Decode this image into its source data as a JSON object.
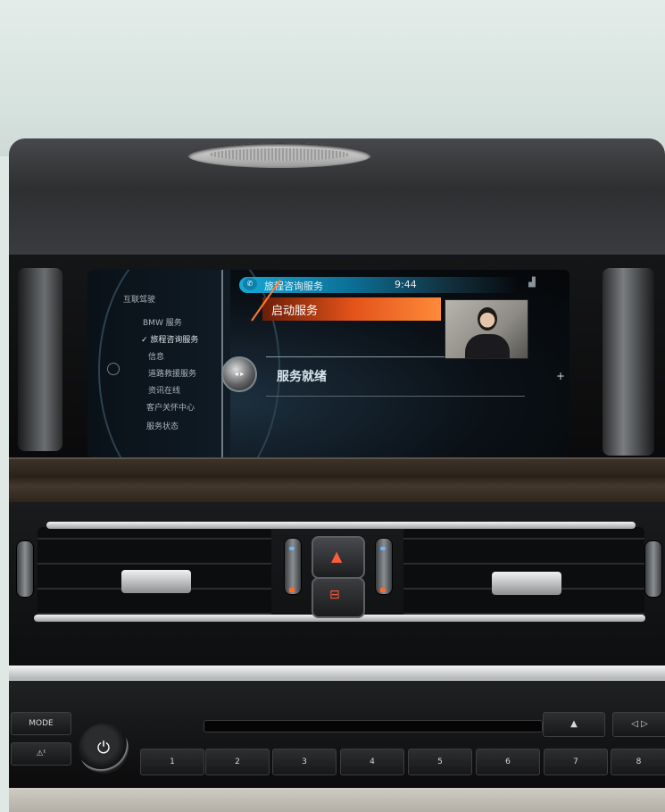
{
  "screen": {
    "left_menu": {
      "header": "互联驾驶",
      "items": [
        {
          "label": "BMW 服务",
          "selected": false
        },
        {
          "label": "✓ 旅程咨询服务",
          "selected": true
        },
        {
          "label": "信息",
          "selected": false
        },
        {
          "label": "道路救援服务",
          "selected": false
        },
        {
          "label": "资讯在线",
          "selected": false
        },
        {
          "label": "客户关怀中心",
          "selected": false
        },
        {
          "label": "服务状态",
          "selected": false
        }
      ]
    },
    "title": "旅程咨询服务",
    "title_icon": "connected-drive-icon",
    "time": "9:44",
    "signal_icon": "signal-strength-icon",
    "selected_option": "启动服务",
    "status_text": "服务就绪",
    "video_feed_icon": "agent-video-icon",
    "controller_icon": "controller-knob-icon",
    "plus_icon": "plus-icon",
    "colors": {
      "accent_blue": "#17a8d6",
      "selection_orange": "#e2521a"
    }
  },
  "center_console": {
    "hazard_icon": "hazard-triangle-icon",
    "lock_icon": "central-lock-icon"
  },
  "radio": {
    "mode_label": "MODE",
    "traffic_icon": "traffic-info-icon",
    "power_icon": "power-icon",
    "presets": [
      "1",
      "2",
      "3",
      "4",
      "5",
      "6",
      "7",
      "8"
    ],
    "eject_icon": "eject-icon",
    "prev_icon": "track-prev-icon"
  }
}
